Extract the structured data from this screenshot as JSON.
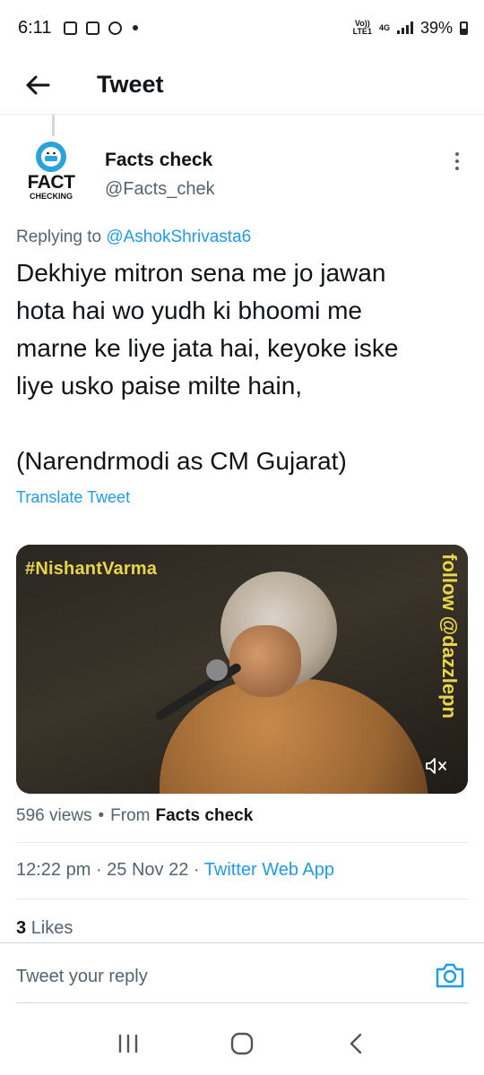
{
  "status_bar": {
    "time": "6:11",
    "network_top": "Vo))",
    "network_bottom": "LTE1",
    "net_type": "4G",
    "battery": "39%"
  },
  "header": {
    "title": "Tweet"
  },
  "tweet": {
    "avatar_text_top": "FACT",
    "avatar_text_bottom": "CHECKING",
    "author_name": "Facts check",
    "author_handle": "@Facts_chek",
    "replying_prefix": "Replying to",
    "replying_to": "@AshokShrivasta6",
    "text_lines": [
      "Dekhiye mitron sena me jo jawan",
      "hota hai wo yudh ki bhoomi me",
      "marne ke liye jata hai, keyoke iske",
      "liye usko paise milte hain,",
      "(Narendrmodi as CM Gujarat)"
    ],
    "translate_label": "Translate Tweet",
    "media": {
      "overlay_tag": "#NishantVarma",
      "overlay_vertical": "follow @dazzlepn"
    },
    "views": "596 views",
    "from_prefix": "From",
    "from_name": "Facts check",
    "time": "12:22 pm",
    "date": "25 Nov 22",
    "source_app": "Twitter Web App",
    "likes_count": "3",
    "likes_label": "Likes"
  },
  "reply": {
    "placeholder": "Tweet your reply"
  },
  "colors": {
    "accent": "#1d9bf0",
    "muted": "#536471",
    "overlay_text": "#e8d64a"
  }
}
